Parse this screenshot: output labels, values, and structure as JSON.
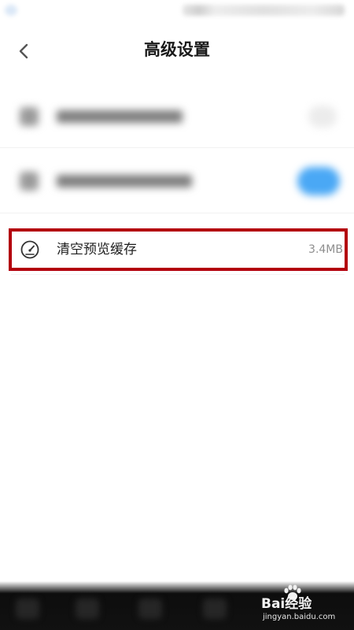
{
  "header": {
    "title": "高级设置",
    "back_icon": "chevron-left-icon"
  },
  "settings": {
    "clear_cache": {
      "label": "清空预览缓存",
      "value": "3.4MB",
      "icon": "gauge-icon",
      "highlight_color": "#b3000c"
    }
  },
  "watermark": {
    "brand": "Bai经验",
    "url": "jingyan.baidu.com"
  },
  "colors": {
    "toggle_on": "#4aa8f5",
    "title_text": "#1a1a1a",
    "secondary_text": "#8e8e8e"
  }
}
